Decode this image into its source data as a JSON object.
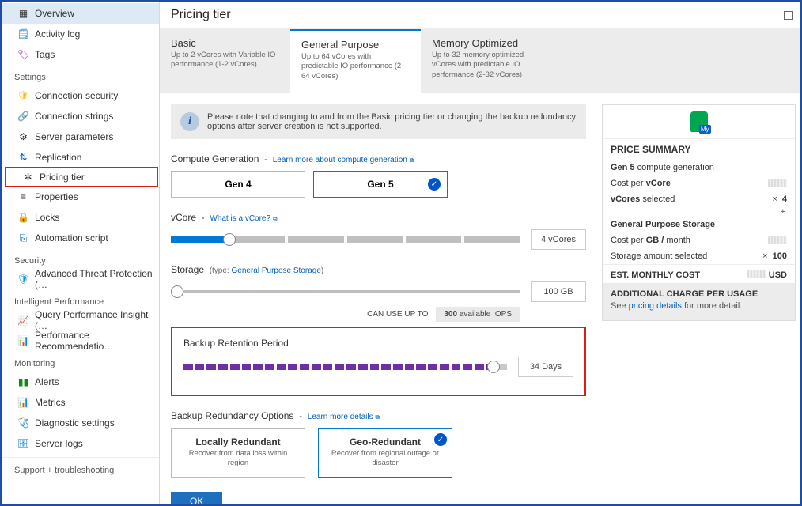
{
  "page_title": "Pricing tier",
  "sidebar": {
    "items_top": [
      {
        "icon": "grid",
        "label": "Overview",
        "active": true
      },
      {
        "icon": "log",
        "label": "Activity log"
      },
      {
        "icon": "tag",
        "label": "Tags"
      }
    ],
    "settings_heading": "Settings",
    "settings_items": [
      {
        "icon": "shield",
        "label": "Connection security"
      },
      {
        "icon": "link",
        "label": "Connection strings"
      },
      {
        "icon": "gear",
        "label": "Server parameters"
      },
      {
        "icon": "repl",
        "label": "Replication"
      },
      {
        "icon": "gear2",
        "label": "Pricing tier",
        "highlight": true
      },
      {
        "icon": "props",
        "label": "Properties"
      },
      {
        "icon": "lock",
        "label": "Locks"
      },
      {
        "icon": "script",
        "label": "Automation script"
      }
    ],
    "security_heading": "Security",
    "security_items": [
      {
        "icon": "atp",
        "label": "Advanced Threat Protection (…"
      }
    ],
    "intel_heading": "Intelligent Performance",
    "intel_items": [
      {
        "icon": "qpi",
        "label": "Query Performance Insight (…"
      },
      {
        "icon": "perf",
        "label": "Performance Recommendatio…"
      }
    ],
    "mon_heading": "Monitoring",
    "mon_items": [
      {
        "icon": "alert",
        "label": "Alerts"
      },
      {
        "icon": "metric",
        "label": "Metrics"
      },
      {
        "icon": "diag",
        "label": "Diagnostic settings"
      },
      {
        "icon": "logs",
        "label": "Server logs"
      }
    ],
    "support_heading": "Support + troubleshooting"
  },
  "tiers": [
    {
      "title": "Basic",
      "desc": "Up to 2 vCores with Variable IO performance (1-2 vCores)"
    },
    {
      "title": "General Purpose",
      "desc": "Up to 64 vCores with predictable IO performance (2-64 vCores)",
      "active": true
    },
    {
      "title": "Memory Optimized",
      "desc": "Up to 32 memory optimized vCores with predictable IO performance (2-32 vCores)"
    }
  ],
  "info_note": "Please note that changing to and from the Basic pricing tier or changing the backup redundancy options after server creation is not supported.",
  "compute": {
    "label": "Compute Generation",
    "link": "Learn more about compute generation",
    "gen4": "Gen 4",
    "gen5": "Gen 5"
  },
  "vcore": {
    "label": "vCore",
    "link": "What is a vCore?",
    "value": "4 vCores"
  },
  "storage": {
    "label": "Storage",
    "type_prefix": "(type:",
    "type_link": "General Purpose Storage",
    "type_suffix": ")",
    "value": "100 GB",
    "iops_label": "CAN USE UP TO",
    "iops_value": "300",
    "iops_suffix": "available IOPS"
  },
  "backup": {
    "label": "Backup Retention Period",
    "value": "34 Days"
  },
  "redundancy": {
    "label": "Backup Redundancy Options",
    "link": "Learn more details",
    "local_title": "Locally Redundant",
    "local_desc": "Recover from data loss within region",
    "geo_title": "Geo-Redundant",
    "geo_desc": "Recover from regional outage or disaster"
  },
  "ok_label": "OK",
  "price": {
    "title": "PRICE SUMMARY",
    "gen_line_a": "Gen 5",
    "gen_line_b": "compute generation",
    "cost_vcore": "Cost per",
    "cost_vcore_b": "vCore",
    "vcores_sel": "vCores",
    "vcores_sel_b": "selected",
    "vcores_val": "4",
    "gp_storage": "General Purpose Storage",
    "cost_gb": "Cost per",
    "cost_gb_b": "GB /",
    "cost_gb_m": "month",
    "storage_sel": "Storage amount selected",
    "storage_val": "100",
    "est": "EST. MONTHLY COST",
    "est_unit": "USD",
    "addl_title": "ADDITIONAL CHARGE PER USAGE",
    "addl_desc_a": "See",
    "addl_link": "pricing details",
    "addl_desc_b": "for more detail."
  }
}
